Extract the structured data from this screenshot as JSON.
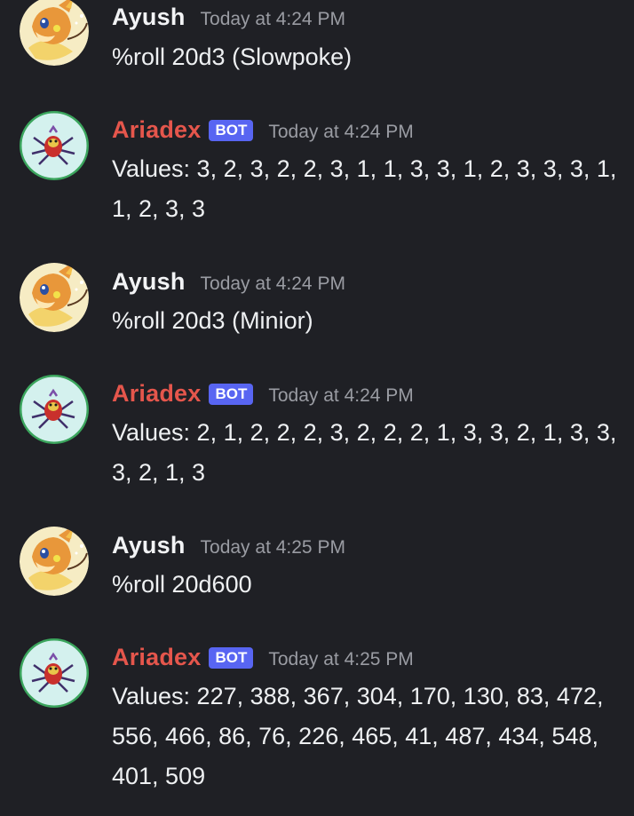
{
  "messages": [
    {
      "author": "Ayush",
      "timestamp": "Today at 4:24 PM",
      "text": "%roll 20d3 (Slowpoke)"
    },
    {
      "author": "Ariadex",
      "badge": "BOT",
      "timestamp": "Today at 4:24 PM",
      "text": "Values: 3, 2, 3, 2, 2, 3, 1, 1, 3, 3, 1, 2, 3, 3, 3, 1, 1, 2, 3, 3"
    },
    {
      "author": "Ayush",
      "timestamp": "Today at 4:24 PM",
      "text": "%roll 20d3 (Minior)"
    },
    {
      "author": "Ariadex",
      "badge": "BOT",
      "timestamp": "Today at 4:24 PM",
      "text": "Values: 2, 1, 2, 2, 2, 3, 2, 2, 2, 1, 3, 3, 2, 1, 3, 3, 3, 2, 1, 3"
    },
    {
      "author": "Ayush",
      "timestamp": "Today at 4:25 PM",
      "text": "%roll 20d600"
    },
    {
      "author": "Ariadex",
      "badge": "BOT",
      "timestamp": "Today at 4:25 PM",
      "text": "Values: 227, 388, 367, 304, 170, 130, 83, 472, 556, 466, 86, 76, 226, 465, 41, 487, 434, 548, 401, 509"
    }
  ],
  "colors": {
    "background": "#1f2025",
    "user_name": "#f2f3f5",
    "bot_name": "#e5564c",
    "bot_badge": "#5865f2",
    "timestamp": "#9a9ca3",
    "bot_avatar_ring": "#3ba55d"
  },
  "icons": {
    "user_avatar": "raichu-avatar-icon",
    "bot_avatar": "ariados-avatar-icon"
  }
}
